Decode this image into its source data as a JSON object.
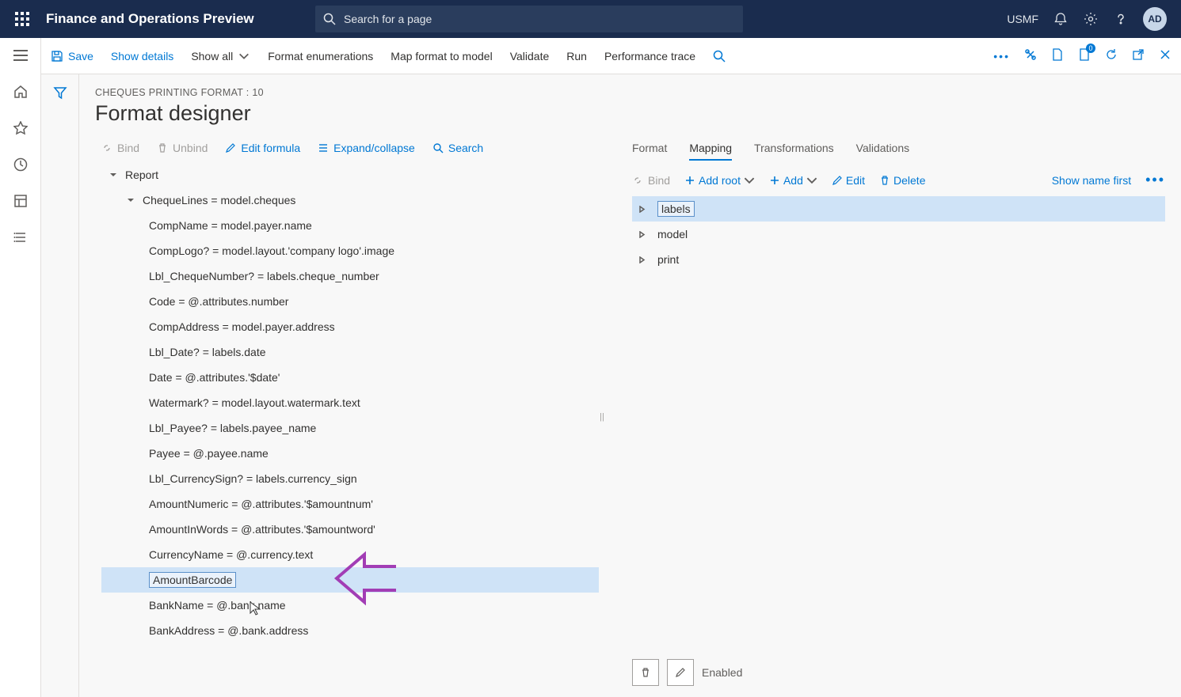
{
  "topbar": {
    "app_title": "Finance and Operations Preview",
    "search_placeholder": "Search for a page",
    "company": "USMF",
    "avatar": "AD"
  },
  "cmdbar": {
    "save": "Save",
    "show_details": "Show details",
    "show_all": "Show all",
    "format_enum": "Format enumerations",
    "map_format": "Map format to model",
    "validate": "Validate",
    "run": "Run",
    "perf_trace": "Performance trace",
    "badge_count": "0"
  },
  "page": {
    "breadcrumb": "CHEQUES PRINTING FORMAT : 10",
    "title": "Format designer"
  },
  "left_toolbar": {
    "bind": "Bind",
    "unbind": "Unbind",
    "edit_formula": "Edit formula",
    "expand_collapse": "Expand/collapse",
    "search": "Search"
  },
  "tree": {
    "root": "Report",
    "cheque_lines": "ChequeLines = model.cheques",
    "items": [
      "CompName = model.payer.name",
      "CompLogo? = model.layout.'company logo'.image",
      "Lbl_ChequeNumber? = labels.cheque_number",
      "Code = @.attributes.number",
      "CompAddress = model.payer.address",
      "Lbl_Date? = labels.date",
      "Date = @.attributes.'$date'",
      "Watermark? = model.layout.watermark.text",
      "Lbl_Payee? = labels.payee_name",
      "Payee = @.payee.name",
      "Lbl_CurrencySign? = labels.currency_sign",
      "AmountNumeric = @.attributes.'$amountnum'",
      "AmountInWords = @.attributes.'$amountword'",
      "CurrencyName = @.currency.text",
      "AmountBarcode",
      "BankName = @.bank.name",
      "BankAddress = @.bank.address"
    ]
  },
  "right_tabs": {
    "format": "Format",
    "mapping": "Mapping",
    "transformations": "Transformations",
    "validations": "Validations"
  },
  "right_toolbar": {
    "bind": "Bind",
    "add_root": "Add root",
    "add": "Add",
    "edit": "Edit",
    "delete": "Delete",
    "show_name_first": "Show name first"
  },
  "right_tree": {
    "items": [
      "labels",
      "model",
      "print"
    ]
  },
  "bottom": {
    "enabled": "Enabled"
  }
}
